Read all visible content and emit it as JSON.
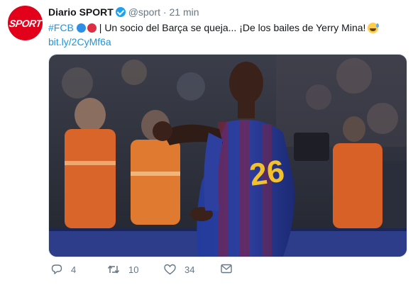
{
  "account": {
    "avatar_text": "SPORT",
    "name": "Diario SPORT",
    "handle": "@sport",
    "separator": "·",
    "time": "21 min"
  },
  "tweet": {
    "hashtag": "#FCB",
    "text": "| Un socio del Barça se queja... ¡De los bailes de Yerry Mina!",
    "link": "bit.ly/2CyMf6a",
    "emoji": "grinning-sweat-face-icon"
  },
  "media": {
    "jersey_number": "26"
  },
  "actions": {
    "replies": "4",
    "retweets": "10",
    "likes": "34"
  },
  "colors": {
    "brand_red": "#e2001a",
    "link_blue": "#1b95e0",
    "muted": "#657786"
  }
}
